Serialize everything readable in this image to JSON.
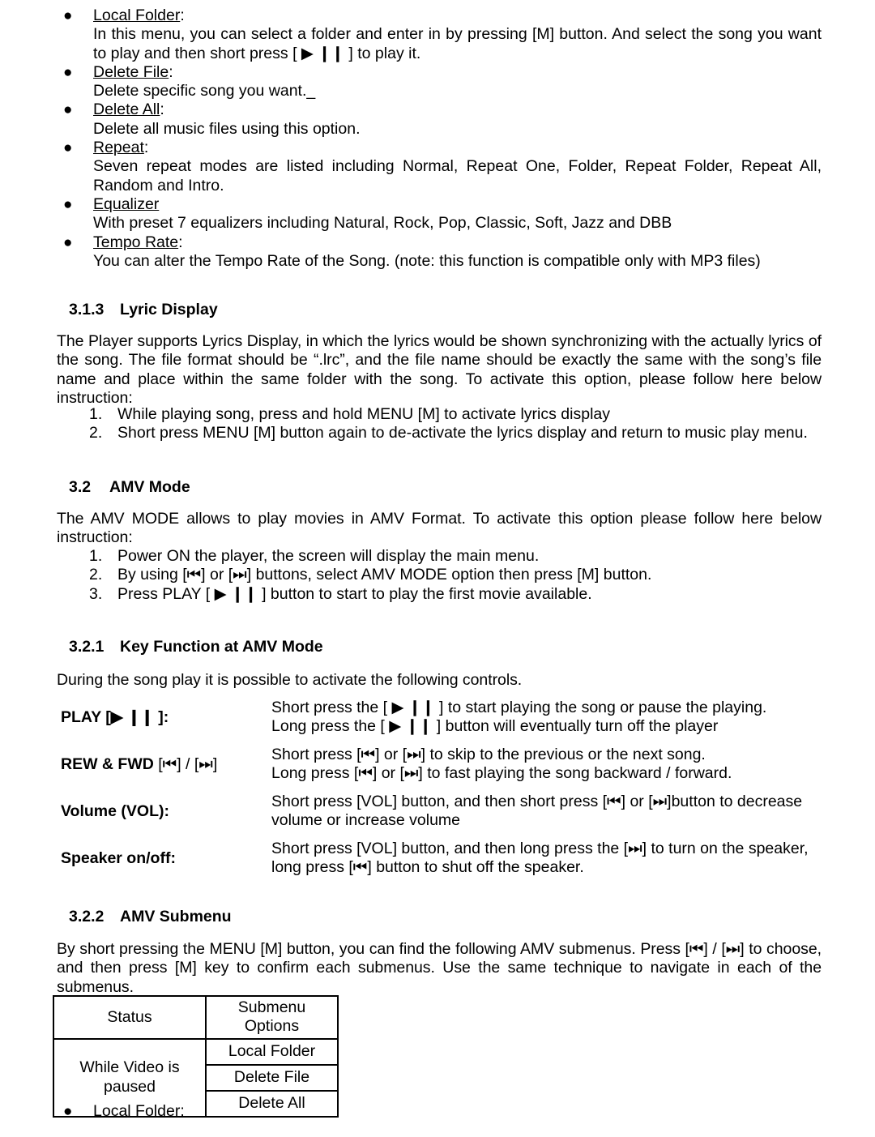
{
  "document": {
    "music_submenu_bullets": [
      {
        "title": "Local Folder",
        "title_suffix": ":",
        "desc": "In this menu, you can select a folder and enter in by pressing [M] button. And select the song you want to play and then short press [ ▶ ❙❙ ] to play it."
      },
      {
        "title": "Delete File",
        "title_suffix": ":",
        "desc": "Delete specific song you want._"
      },
      {
        "title": "Delete All",
        "title_suffix": ":",
        "desc": "Delete all music files using this option."
      },
      {
        "title": "Repeat",
        "title_suffix": ":",
        "desc": "Seven repeat modes are listed including Normal, Repeat One, Folder, Repeat Folder, Repeat All, Random and Intro."
      },
      {
        "title": "Equalizer",
        "title_suffix": "",
        "desc": "With preset 7 equalizers including Natural, Rock, Pop, Classic, Soft, Jazz and DBB"
      },
      {
        "title": "Tempo Rate",
        "title_suffix": ":",
        "desc": "You can alter the Tempo Rate of the Song. (note: this function is compatible only with MP3 files)"
      }
    ],
    "lyric_display": {
      "heading_number": "3.1.3",
      "heading_text": "Lyric Display",
      "paragraph": "The Player supports Lyrics Display, in which the lyrics would be shown synchronizing with the actually lyrics of the song. The file format should be “.lrc”, and the file name should be exactly the same with the song’s file name and place within the same folder with the song. To activate this option, please follow here below instruction:",
      "steps": [
        {
          "marker": "1.",
          "text": "While playing song, press and hold MENU [M] to activate lyrics display"
        },
        {
          "marker": "2.",
          "text": "Short press MENU [M] button again to de-activate the lyrics display and return to music play menu."
        }
      ]
    },
    "amv_mode": {
      "heading_number": "3.2",
      "heading_text": "AMV Mode",
      "paragraph": "The AMV MODE allows to play movies in AMV Format. To activate this option please follow here below instruction:",
      "steps": [
        {
          "marker": "1.",
          "text": "Power ON the player, the screen will display the main menu."
        },
        {
          "marker": "2.",
          "text": "By using [⏮] or [⏭] buttons, select AMV MODE option then press [M] button."
        },
        {
          "marker": "3.",
          "text": "Press PLAY [ ▶ ❙❙ ] button to start to play the first movie available."
        }
      ]
    },
    "key_function": {
      "heading_number": "3.2.1",
      "heading_text": "Key Function at AMV Mode",
      "intro": "During the song play it is possible to activate the following controls.",
      "rows": [
        {
          "label_bold": "PLAY [▶ ❙❙ ]:",
          "label_regular": "",
          "lines": [
            "Short press the [ ▶ ❙❙ ] to start playing the song or pause the playing.",
            "Long press the [ ▶ ❙❙ ] button will eventually turn off the player"
          ]
        },
        {
          "label_bold": "REW & FWD",
          "label_regular": " [⏮] / [⏭]",
          "lines": [
            "Short press [⏮] or [⏭] to skip to the previous or the next song.",
            "Long press [⏮] or [⏭] to fast playing the song backward / forward."
          ]
        },
        {
          "label_bold": "Volume (VOL):",
          "label_regular": "",
          "lines": [
            "Short press [VOL] button, and then short press [⏮] or [⏭]button to decrease",
            "volume or increase volume"
          ]
        },
        {
          "label_bold": "Speaker on/off:",
          "label_regular": "",
          "lines": [
            "Short press [VOL] button, and then long press the [⏭] to turn on the speaker,",
            "long press [⏮] button to shut off the speaker."
          ]
        }
      ]
    },
    "amv_submenu": {
      "heading_number": "3.2.2",
      "heading_text": "AMV Submenu",
      "paragraph": "By short pressing the MENU [M] button, you can find the following AMV submenus. Press [⏮] / [⏭] to choose, and then press [M] key to confirm each submenus. Use the same technique to navigate in each of the submenus.",
      "table": {
        "headers": [
          "Status",
          "Submenu Options"
        ],
        "header_line1": "Submenu",
        "header_line2": "Options",
        "status_line1": "While Video is",
        "status_line2": "paused",
        "options": [
          "Local Folder",
          "Delete File",
          "Delete All"
        ]
      },
      "trailing_bullet": {
        "title": "Local Folder",
        "title_suffix": ":"
      }
    }
  },
  "icons": {
    "bullet": "●",
    "play": "▶",
    "pause": "❙❙",
    "prev": "⏮",
    "next": "⏭"
  }
}
